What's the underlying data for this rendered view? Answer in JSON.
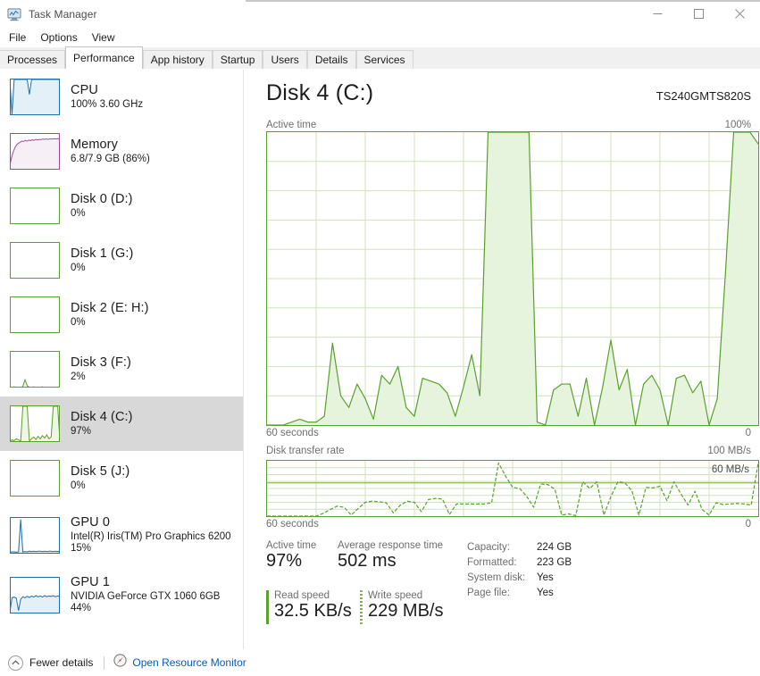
{
  "window": {
    "title": "Task Manager",
    "icon": "task-manager-icon",
    "minimize": "—",
    "maximize": "□",
    "close": "✕"
  },
  "menu": {
    "items": [
      "File",
      "Options",
      "View"
    ]
  },
  "tabs": {
    "items": [
      {
        "label": "Processes",
        "active": false
      },
      {
        "label": "Performance",
        "active": true
      },
      {
        "label": "App history",
        "active": false
      },
      {
        "label": "Startup",
        "active": false
      },
      {
        "label": "Users",
        "active": false
      },
      {
        "label": "Details",
        "active": false
      },
      {
        "label": "Services",
        "active": false
      }
    ]
  },
  "sidebar": {
    "items": [
      {
        "name": "CPU",
        "sub": "100%  3.60 GHz",
        "sub2": "",
        "accent": "#1f6fa8",
        "fill": "#e3f0f8",
        "selected": false,
        "thumb": "cpu"
      },
      {
        "name": "Memory",
        "sub": "6.8/7.9 GB (86%)",
        "sub2": "",
        "accent": "#a0499a",
        "fill": "#f7eff6",
        "selected": false,
        "thumb": "memory"
      },
      {
        "name": "Disk 0 (D:)",
        "sub": "0%",
        "sub2": "",
        "accent": "#5aa02c",
        "fill": "#eef7e6",
        "selected": false,
        "thumb": "flat"
      },
      {
        "name": "Disk 1 (G:)",
        "sub": "0%",
        "sub2": "",
        "accent": "#5aa02c",
        "fill": "#eef7e6",
        "selected": false,
        "thumb": "flat"
      },
      {
        "name": "Disk 2 (E: H:)",
        "sub": "0%",
        "sub2": "",
        "accent": "#5aa02c",
        "fill": "#eef7e6",
        "selected": false,
        "thumb": "flat"
      },
      {
        "name": "Disk 3 (F:)",
        "sub": "2%",
        "sub2": "",
        "accent": "#5aa02c",
        "fill": "#eef7e6",
        "selected": false,
        "thumb": "disk3"
      },
      {
        "name": "Disk 4 (C:)",
        "sub": "97%",
        "sub2": "",
        "accent": "#5aa02c",
        "fill": "#eef7e6",
        "selected": true,
        "thumb": "disk4"
      },
      {
        "name": "Disk 5 (J:)",
        "sub": "0%",
        "sub2": "",
        "accent": "#5aa02c",
        "fill": "#eef7e6",
        "selected": false,
        "thumb": "flat"
      },
      {
        "name": "GPU 0",
        "sub": "Intel(R) Iris(TM) Pro Graphics 6200",
        "sub2": "15%",
        "accent": "#1f6fa8",
        "fill": "#e3f0f8",
        "selected": false,
        "thumb": "gpu0"
      },
      {
        "name": "GPU 1",
        "sub": "NVIDIA GeForce GTX 1060 6GB",
        "sub2": "44%",
        "accent": "#1f6fa8",
        "fill": "#e3f0f8",
        "selected": false,
        "thumb": "gpu1"
      }
    ]
  },
  "main": {
    "title": "Disk 4 (C:)",
    "model": "TS240GMTS820S",
    "active_time_label": "Active time",
    "active_time_max": "100%",
    "time_span_label": "60 seconds",
    "time_zero_label": "0",
    "transfer_label": "Disk transfer rate",
    "transfer_max": "100 MB/s",
    "transfer_mid": "60 MB/s",
    "transfer_zero": "0"
  },
  "stats": {
    "active_time_label": "Active time",
    "active_time_value": "97%",
    "response_label": "Average response time",
    "response_value": "502 ms",
    "read_label": "Read speed",
    "read_value": "32.5 KB/s",
    "write_label": "Write speed",
    "write_value": "229 MB/s",
    "info": [
      {
        "key": "Capacity:",
        "value": "224 GB"
      },
      {
        "key": "Formatted:",
        "value": "223 GB"
      },
      {
        "key": "System disk:",
        "value": "Yes"
      },
      {
        "key": "Page file:",
        "value": "Yes"
      }
    ]
  },
  "footer": {
    "fewer_details": "Fewer details",
    "fewer_icon": "chevron-up-circle-icon",
    "resource_monitor": "Open Resource Monitor",
    "resource_icon": "resource-monitor-icon"
  },
  "colors": {
    "graph_border": "#5aa02c",
    "graph_line": "#5aa02c",
    "graph_fill": "#e7f4dd",
    "grid": "#cfe3bd",
    "link": "#0a5ab4",
    "selected_row": "#d8d8d8"
  },
  "chart_data": [
    {
      "type": "area",
      "title": "Active time",
      "ylabel": "",
      "xlabel": "60 seconds",
      "ylim": [
        0,
        100
      ],
      "xlim": [
        60,
        0
      ],
      "grid": true,
      "axis_right_label": "100%",
      "values": [
        0,
        0,
        0,
        1,
        2,
        1,
        1,
        3,
        28,
        10,
        6,
        14,
        9,
        2,
        17,
        14,
        20,
        6,
        3,
        16,
        15,
        14,
        11,
        3,
        13,
        24,
        10,
        100,
        100,
        100,
        100,
        100,
        100,
        1,
        0,
        12,
        14,
        14,
        3,
        16,
        0,
        13,
        29,
        12,
        19,
        0,
        14,
        17,
        12,
        0,
        16,
        17,
        11,
        15,
        0,
        9,
        52,
        100,
        100,
        100,
        96
      ]
    },
    {
      "type": "area",
      "title": "Disk transfer rate",
      "ylabel": "",
      "xlabel": "60 seconds",
      "ylim": [
        0,
        100
      ],
      "xlim": [
        60,
        0
      ],
      "grid": true,
      "axis_right_label": "100 MB/s",
      "reference_line": 60,
      "reference_label": "60 MB/s",
      "values": [
        0,
        0,
        0,
        0,
        0,
        0,
        0,
        0,
        5,
        12,
        18,
        16,
        2,
        14,
        25,
        27,
        26,
        24,
        6,
        20,
        27,
        25,
        8,
        30,
        32,
        31,
        3,
        22,
        22,
        22,
        22,
        22,
        24,
        96,
        72,
        52,
        50,
        36,
        16,
        58,
        57,
        49,
        2,
        4,
        1,
        62,
        50,
        62,
        2,
        35,
        62,
        60,
        46,
        2,
        52,
        51,
        54,
        28,
        62,
        40,
        20,
        45,
        12,
        2,
        24,
        21,
        22,
        23,
        22,
        20,
        96
      ]
    }
  ]
}
